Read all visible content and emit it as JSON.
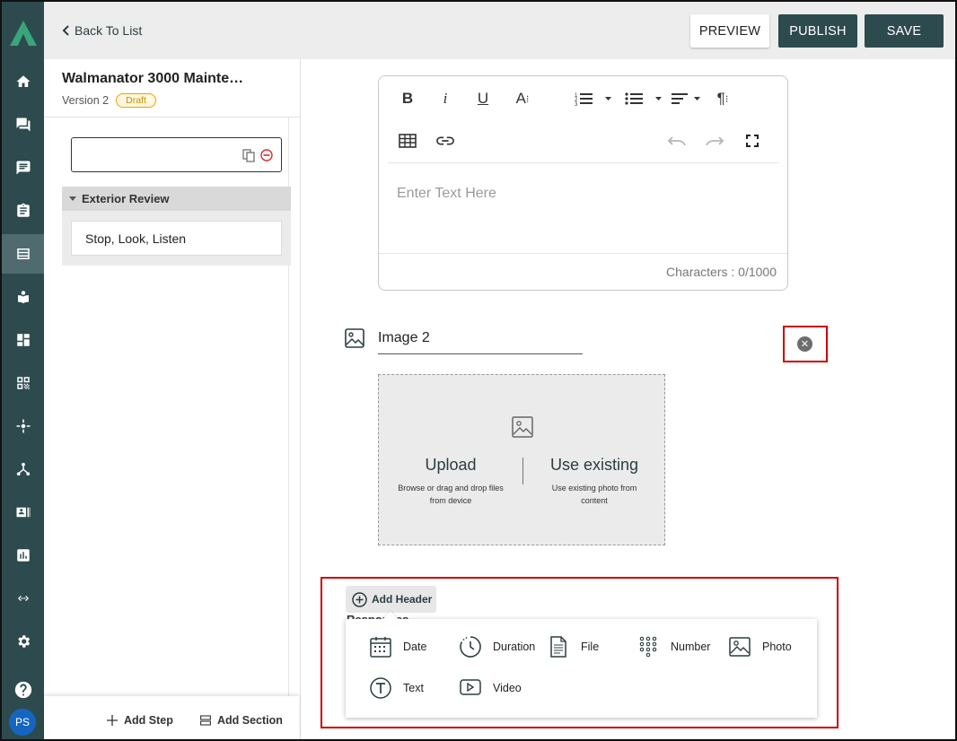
{
  "topbar": {
    "back_label": "Back To List",
    "preview_label": "PREVIEW",
    "publish_label": "PUBLISH",
    "save_label": "SAVE"
  },
  "rail": {
    "items": [
      "home-icon",
      "chat-icon",
      "message-icon",
      "clipboard-icon",
      "checklist-icon",
      "book-icon",
      "dashboard-icon",
      "qr-code-icon",
      "hub-icon",
      "tree-icon",
      "id-card-icon",
      "chart-icon",
      "code-icon",
      "settings-icon",
      "help-icon"
    ],
    "active_index": 4,
    "avatar_initials": "PS"
  },
  "left_panel": {
    "title": "Walmanator 3000 Mainte…",
    "version": "Version 2",
    "status_badge": "Draft",
    "step_input_value": "",
    "section_title": "Exterior Review",
    "steps": [
      "Stop, Look, Listen"
    ],
    "add_step_label": "Add Step",
    "add_section_label": "Add Section"
  },
  "editor": {
    "placeholder": "Enter Text Here",
    "char_count": "Characters : 0/1000",
    "toolbar_row1": [
      "bold",
      "italic",
      "underline",
      "font-size",
      "ordered-list",
      "unordered-list",
      "align",
      "paragraph"
    ],
    "toolbar_row2": [
      "table",
      "link",
      "undo",
      "redo",
      "fullscreen"
    ]
  },
  "image_block": {
    "title": "Image 2",
    "upload_heading": "Upload",
    "upload_sub": "Browse or drag and drop files from device",
    "existing_heading": "Use existing",
    "existing_sub": "Use existing photo from content"
  },
  "add_menu": {
    "header_button": "Add Header",
    "behind_text": "Responses",
    "options": [
      {
        "label": "Date",
        "icon": "calendar-icon"
      },
      {
        "label": "Duration",
        "icon": "clock-icon"
      },
      {
        "label": "File",
        "icon": "file-icon"
      },
      {
        "label": "Number",
        "icon": "keypad-icon"
      },
      {
        "label": "Photo",
        "icon": "photo-icon"
      },
      {
        "label": "Text",
        "icon": "text-icon"
      },
      {
        "label": "Video",
        "icon": "video-icon"
      }
    ]
  },
  "colors": {
    "brand_dark": "#2d4a4e",
    "highlight": "#cc0000",
    "draft_badge": "#e8a400"
  }
}
